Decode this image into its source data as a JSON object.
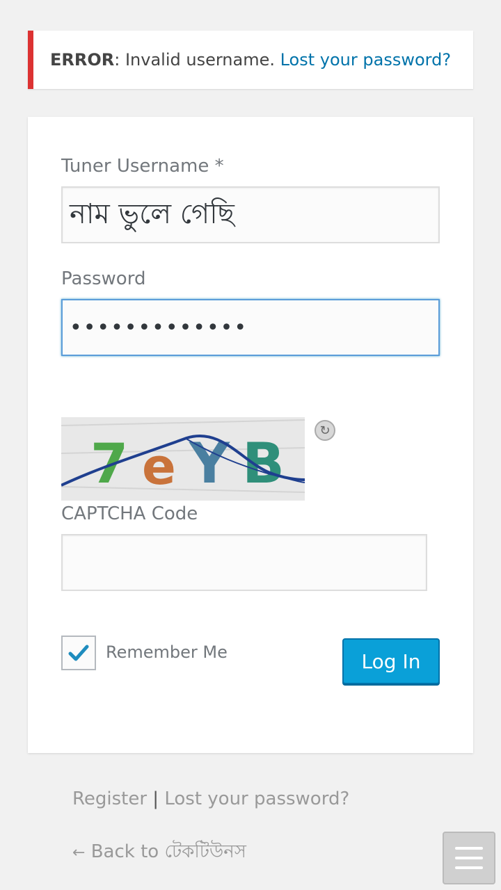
{
  "error": {
    "strong": "ERROR",
    "message": ": Invalid username. ",
    "link": "Lost your password?"
  },
  "form": {
    "username_label": "Tuner Username *",
    "username_value": "নাম ভুলে গেছি",
    "password_label": "Password",
    "password_value": "•••••••••••••",
    "captcha_label": "CAPTCHA Code",
    "captcha_value": "",
    "remember_label": "Remember Me",
    "remember_checked": true,
    "login_label": "Log In"
  },
  "captcha": {
    "chars": [
      "7",
      "e",
      "Y",
      "B"
    ],
    "colors": [
      "#4fa84a",
      "#c9733b",
      "#4a7fa0",
      "#2f8f7a"
    ],
    "line_color": "#1f3f8f"
  },
  "footer": {
    "register": "Register",
    "separator": " | ",
    "lost_password": "Lost your password?",
    "back_arrow": "←",
    "back_text": " Back to টেকটিউনস"
  },
  "icons": {
    "refresh": "refresh-icon",
    "check": "check-icon",
    "menu": "hamburger-menu-icon"
  }
}
